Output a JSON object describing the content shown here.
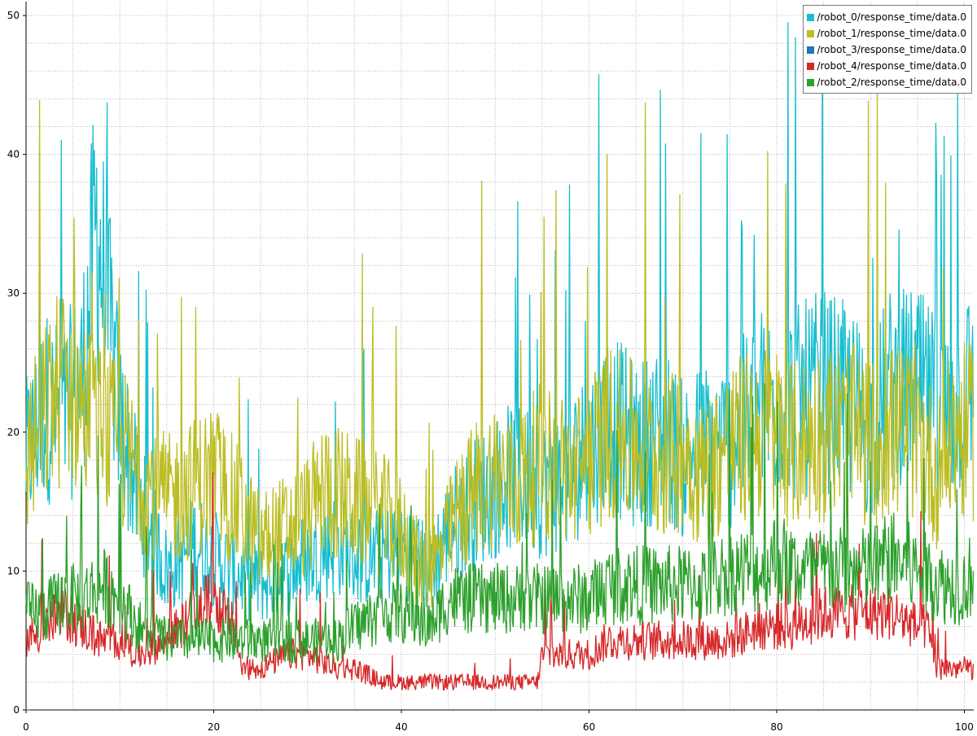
{
  "chart_data": {
    "type": "line",
    "title": "",
    "xlabel": "",
    "ylabel": "",
    "xlim": [
      0,
      101
    ],
    "ylim": [
      0,
      51
    ],
    "x_major_ticks": [
      0,
      20,
      40,
      60,
      80,
      100
    ],
    "y_major_ticks": [
      0,
      10,
      20,
      30,
      40,
      50
    ],
    "x_tick_labels": [
      "0",
      "20",
      "40",
      "60",
      "80",
      "100"
    ],
    "y_tick_labels": [
      "0",
      "10",
      "20",
      "30",
      "40",
      "50"
    ],
    "grid": true,
    "legend_position": "top-right",
    "series": [
      {
        "name": "/robot_0/response_time/data.0",
        "color": "#17becf",
        "x": [
          0,
          2,
          4,
          6,
          7.5,
          10,
          12,
          15,
          18,
          20,
          22,
          25,
          28,
          30,
          33,
          35,
          38,
          40,
          43,
          45,
          48,
          50,
          52,
          55,
          58,
          60,
          62,
          65,
          68,
          70,
          72,
          75,
          78,
          80,
          82,
          85,
          88,
          90,
          92,
          95,
          98,
          100,
          101
        ],
        "y": [
          18,
          22,
          21,
          24,
          35,
          21,
          15,
          10,
          12,
          11,
          10,
          9,
          10,
          11,
          12,
          11,
          11,
          12,
          10,
          13,
          15,
          16,
          17,
          16,
          17,
          19,
          21,
          19,
          20,
          18,
          19,
          19,
          22,
          22,
          22,
          23,
          22,
          20,
          23,
          23,
          21,
          23,
          23
        ]
      },
      {
        "name": "/robot_1/response_time/data.0",
        "color": "#bcbd22",
        "x": [
          0,
          2,
          4,
          6,
          8,
          10,
          12,
          15,
          18,
          20,
          22,
          25,
          28,
          30,
          32,
          35,
          38,
          40,
          42,
          44,
          46,
          48,
          50,
          52,
          55,
          58,
          60,
          62,
          65,
          68,
          70,
          72,
          75,
          78,
          80,
          82,
          85,
          88,
          90,
          92,
          95,
          97,
          99,
          101
        ],
        "y": [
          18,
          21,
          24,
          22,
          20,
          19,
          17,
          15,
          16,
          17,
          15,
          12,
          13,
          14,
          16,
          15,
          14,
          13,
          10,
          11,
          14,
          16,
          17,
          16,
          18,
          17,
          18,
          20,
          19,
          18,
          19,
          17,
          19,
          20,
          20,
          19,
          20,
          20,
          19,
          20,
          20,
          17,
          20,
          20
        ]
      },
      {
        "name": "/robot_3/response_time/data.0",
        "color": "#1f77b4",
        "x": [
          0,
          0.5
        ],
        "y": [
          0,
          0
        ]
      },
      {
        "name": "/robot_4/response_time/data.0",
        "color": "#d62728",
        "x": [
          0,
          2,
          4,
          6,
          8,
          10,
          12,
          15,
          18,
          20,
          22,
          23,
          25,
          28,
          30,
          33,
          35,
          38,
          40,
          43,
          45,
          48,
          50,
          52,
          54.5,
          55,
          58,
          60,
          62,
          65,
          68,
          70,
          72,
          75,
          78,
          80,
          82,
          85,
          88,
          90,
          92,
          95,
          96,
          97,
          99,
          101
        ],
        "y": [
          5,
          6,
          7,
          6,
          5,
          5,
          4,
          5,
          7,
          8,
          6,
          3,
          3,
          4,
          4,
          3,
          3,
          2,
          2,
          2,
          2,
          2,
          2,
          2,
          2,
          4,
          4,
          4,
          5,
          5,
          5,
          5,
          5,
          5,
          6,
          6,
          6,
          7,
          7,
          7,
          7,
          6,
          6,
          3,
          3,
          3
        ]
      },
      {
        "name": "/robot_2/response_time/data.0",
        "color": "#2ca02c",
        "x": [
          0,
          2,
          4,
          6,
          8,
          10,
          12,
          15,
          18,
          20,
          22,
          25,
          28,
          30,
          33,
          35,
          38,
          40,
          43,
          45,
          48,
          50,
          52,
          55,
          58,
          60,
          62,
          65,
          68,
          70,
          72,
          75,
          78,
          80,
          82,
          85,
          88,
          90,
          92,
          95,
          98,
          100,
          101
        ],
        "y": [
          7,
          7,
          8,
          8,
          9,
          8,
          6,
          5,
          5,
          5,
          5,
          5,
          5,
          5,
          5,
          6,
          7,
          7,
          6,
          8,
          8,
          8,
          8,
          8,
          8,
          8,
          9,
          9,
          9,
          9,
          9,
          10,
          10,
          11,
          10,
          10,
          10,
          10,
          11,
          10,
          9,
          9,
          10
        ]
      }
    ]
  }
}
